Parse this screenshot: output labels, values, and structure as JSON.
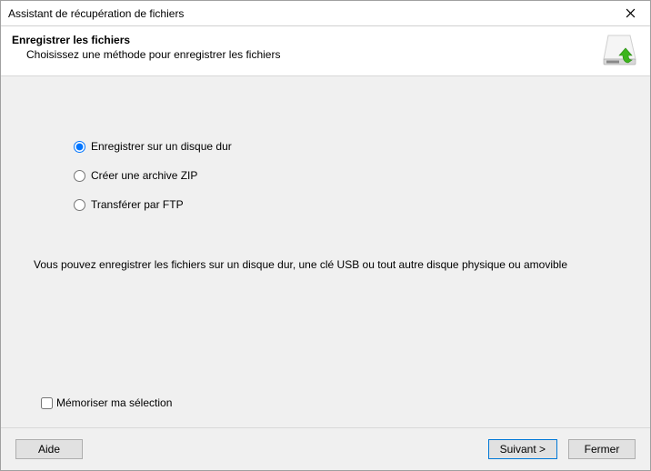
{
  "window": {
    "title": "Assistant de récupération de fichiers"
  },
  "header": {
    "heading": "Enregistrer les fichiers",
    "subheading": "Choisissez une méthode pour enregistrer les fichiers"
  },
  "options": {
    "save_disk": "Enregistrer sur un disque dur",
    "create_zip": "Créer une archive ZIP",
    "ftp": "Transférer par FTP",
    "selected": "save_disk"
  },
  "description": "Vous pouvez enregistrer les fichiers sur un disque dur, une clé USB ou tout autre disque physique ou amovible",
  "remember": {
    "label": "Mémoriser ma sélection",
    "checked": false
  },
  "buttons": {
    "help": "Aide",
    "next": "Suivant >",
    "close": "Fermer"
  }
}
